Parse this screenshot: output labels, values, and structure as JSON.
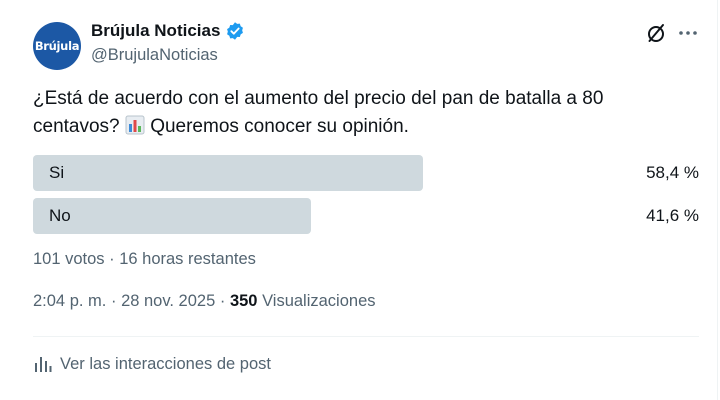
{
  "author": {
    "name": "Brújula Noticias",
    "handle": "@BrujulaNoticias",
    "avatar_text": "Brújula",
    "avatar_color": "#1c58a5",
    "verified_color": "#1d9bf0"
  },
  "header_icons": [
    "grok-icon",
    "more-icon"
  ],
  "post": {
    "text_before_emoji": "¿Está de acuerdo con el aumento del precio del pan de batalla a 80 centavos?",
    "emoji": "bar-chart-emoji",
    "text_after_emoji": "Queremos conocer su opinión."
  },
  "poll": {
    "options": [
      {
        "label": "Si",
        "percent_text": "58,4 %",
        "percent": 58.4
      },
      {
        "label": "No",
        "percent_text": "41,6 %",
        "percent": 41.6
      }
    ],
    "bar_color": "#cfd9de",
    "summary": "101 votos · 16 horas restantes"
  },
  "meta": {
    "time": "2:04 p. m.",
    "separator": "·",
    "date": "28 nov. 2025",
    "views_count": "350",
    "views_label": "Visualizaciones"
  },
  "interactions_link": "Ver las interacciones de post",
  "colors": {
    "text": "#0f1419",
    "secondary": "#536471",
    "divider": "#eff3f4"
  }
}
